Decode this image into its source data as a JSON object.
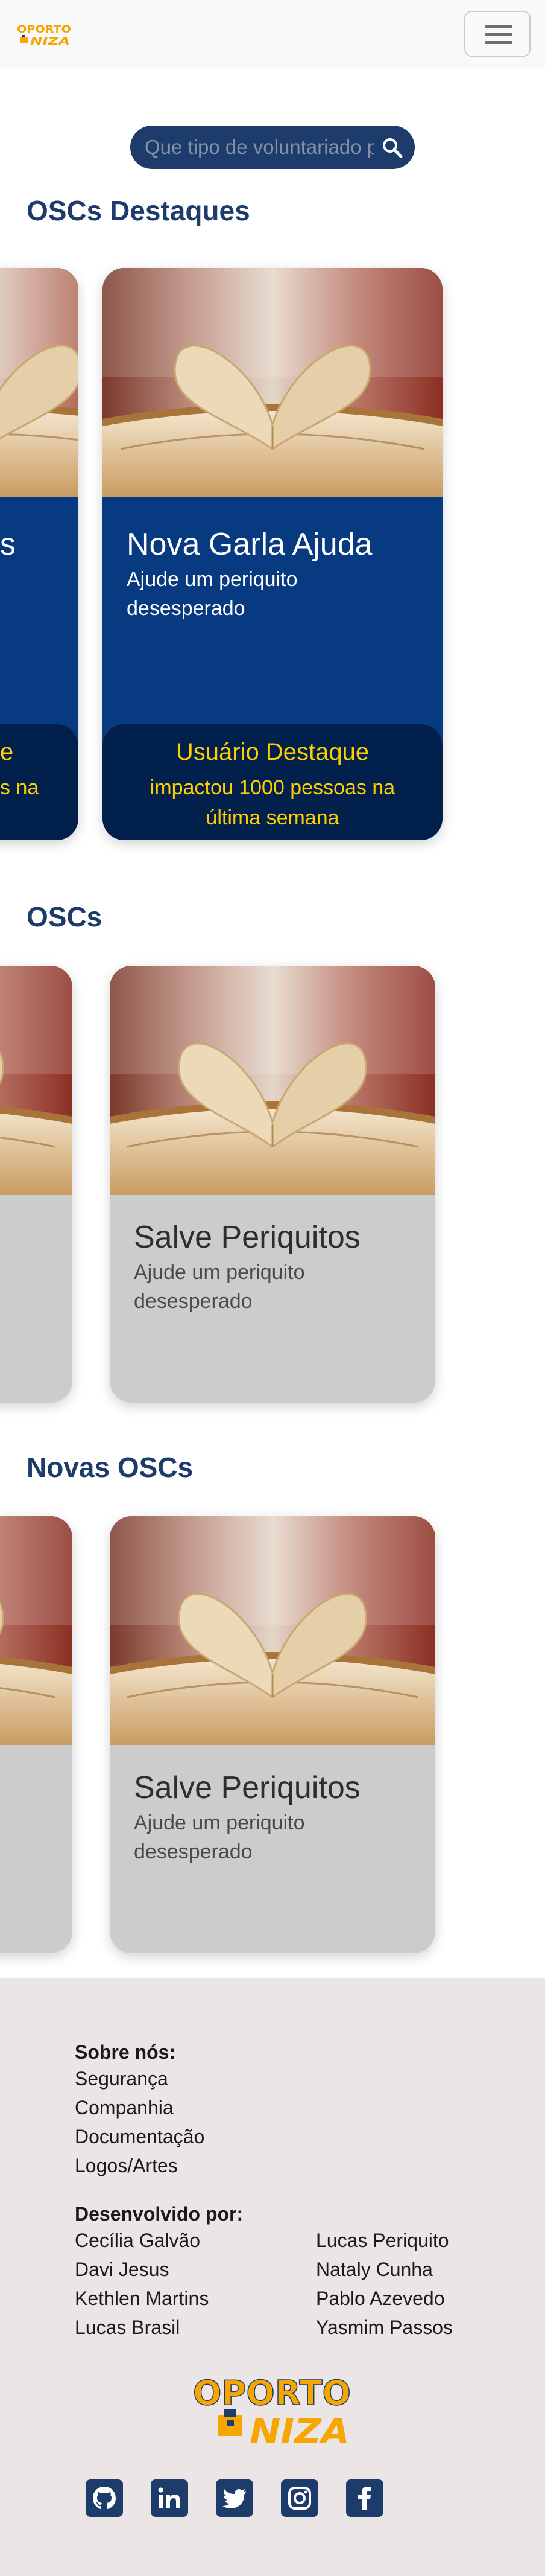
{
  "brand": {
    "logo_line1": "OPORTO",
    "logo_line2": "NIZA"
  },
  "colors": {
    "primary": "#1d3c6c",
    "card_featured": "#073a80",
    "badge_bg": "#01214c",
    "badge_text": "#ffcd00",
    "card_regular": "#cccccc",
    "logo_orange": "#f7a600",
    "logo_dark": "#1d3c6c",
    "footer_bg": "#ece5e6"
  },
  "navbar": {
    "menu_icon": "hamburger-menu-icon"
  },
  "search": {
    "placeholder": "Que tipo de voluntariado procura?",
    "icon": "search-icon"
  },
  "sections": {
    "featured": {
      "title": "OSCs Destaques",
      "partial_card": {
        "title": "s",
        "badge_line1": "e",
        "badge_line2": "s na"
      },
      "card": {
        "title": "Nova Garla Ajuda",
        "description": "Ajude um periquito desesperado",
        "badge_title": "Usuário Destaque",
        "badge_text": "impactou 1000 pessoas na última semana"
      }
    },
    "oscs": {
      "title": "OSCs",
      "card": {
        "title": "Salve Periquitos",
        "description": "Ajude um periquito desesperado"
      }
    },
    "new_oscs": {
      "title": "Novas OSCs",
      "card": {
        "title": "Salve Periquitos",
        "description": "Ajude um periquito desesperado"
      }
    }
  },
  "footer": {
    "about_heading": "Sobre nós:",
    "about_links": [
      "Segurança",
      "Companhia",
      "Documentação",
      "Logos/Artes"
    ],
    "dev_heading": "Desenvolvido por:",
    "developers_left": [
      "Cecília Galvão",
      "Davi Jesus",
      "Kethlen Martins",
      "Lucas Brasil"
    ],
    "developers_right": [
      "Lucas Periquito",
      "Nataly Cunha",
      "Pablo Azevedo",
      "Yasmim Passos"
    ],
    "social_icons": [
      "github-icon",
      "linkedin-icon",
      "twitter-icon",
      "instagram-icon",
      "facebook-icon"
    ]
  }
}
